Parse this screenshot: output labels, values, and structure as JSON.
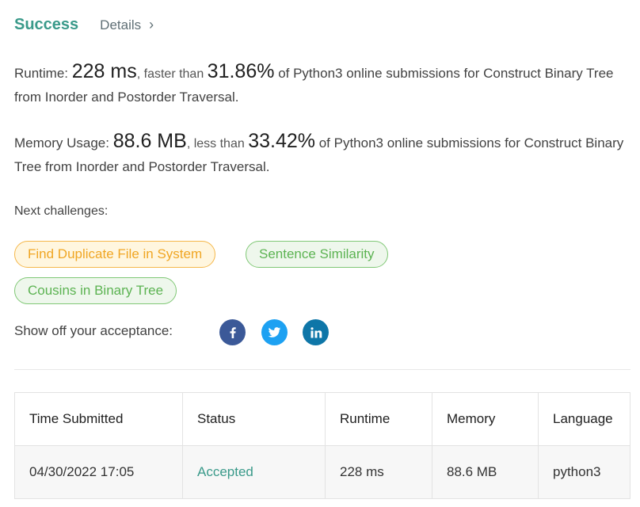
{
  "header": {
    "status": "Success",
    "details_label": "Details",
    "details_chevron": "›"
  },
  "runtime": {
    "label": "Runtime: ",
    "value": "228 ms",
    "mid": ", faster than ",
    "percent": "31.86%",
    "tail": " of Python3 online submissions for Construct Binary Tree from Inorder and Postorder Traversal."
  },
  "memory": {
    "label": "Memory Usage: ",
    "value": "88.6 MB",
    "mid": ", less than ",
    "percent": "33.42%",
    "tail": " of Python3 online submissions for Construct Binary Tree from Inorder and Postorder Traversal."
  },
  "next_challenges": {
    "label": "Next challenges:",
    "items": [
      {
        "title": "Find Duplicate File in System",
        "difficulty": "medium"
      },
      {
        "title": "Sentence Similarity",
        "difficulty": "easy"
      },
      {
        "title": "Cousins in Binary Tree",
        "difficulty": "easy"
      }
    ]
  },
  "share": {
    "label": "Show off your acceptance:",
    "icons": [
      "facebook-icon",
      "twitter-icon",
      "linkedin-icon"
    ]
  },
  "colors": {
    "accent": "#3a9a8a",
    "medium_text": "#f0a624",
    "easy_text": "#5cb352",
    "facebook": "#3b5998",
    "twitter": "#1da1f2",
    "linkedin": "#0e76a8"
  },
  "table": {
    "headers": [
      "Time Submitted",
      "Status",
      "Runtime",
      "Memory",
      "Language"
    ],
    "rows": [
      [
        "04/30/2022 17:05",
        "Accepted",
        "228 ms",
        "88.6 MB",
        "python3"
      ]
    ]
  }
}
